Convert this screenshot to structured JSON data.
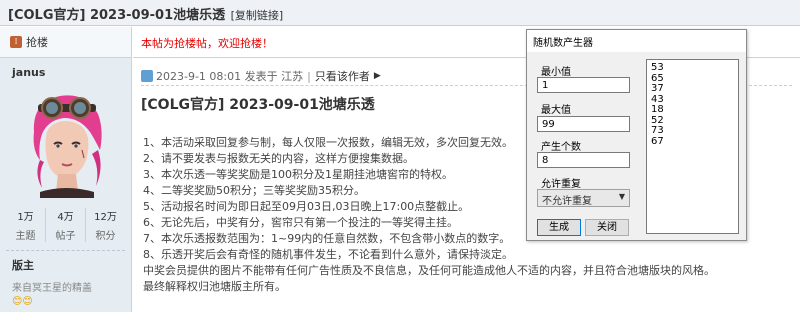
{
  "title_bar": {
    "title": "[COLG官方] 2023-09-01池塘乐透",
    "copy_link": "[复制链接]"
  },
  "sidebar": {
    "floor_label": "抢楼",
    "username": "janus",
    "stats": [
      {
        "value": "1万",
        "key": "主题"
      },
      {
        "value": "4万",
        "key": "帖子"
      },
      {
        "value": "12万",
        "key": "积分"
      }
    ],
    "group": "版主",
    "from": "来自冥王星的精盖",
    "emoji": "😊😊"
  },
  "post": {
    "notice": "本帖为抢楼帖，欢迎抢楼！",
    "meta_text": "2023-9-1 08:01 发表于 江苏",
    "separator": "|",
    "only_author": "只看该作者",
    "title": "[COLG官方] 2023-09-01池塘乐透",
    "lines": [
      "1、本活动采取回复参与制，每人仅限一次报数，编辑无效，多次回复无效。",
      "2、请不要发表与报数无关的内容，这样方便搜集数据。",
      "3、本次乐透一等奖奖励是100积分及1星期挂池塘窖帘的特权。",
      "4、二等奖奖励50积分；三等奖奖励35积分。",
      "5、活动报名时间为即日起至09月03日,03日晚上17:00点整截止。",
      "6、无论先后，中奖有分，窖帘只有第一个投注的一等奖得主挂。",
      "7、本次乐透报数范围为：1~99内的任意自然数，不包含带小数点的数字。",
      "8、乐透开奖后会有奇怪的随机事件发生，不论看到什么意外，请保持淡定。",
      "中奖会员提供的图片不能带有任何广告性质及不良信息，及任何可能造成他人不适的内容，并且符合池塘版块的风格。",
      "最终解释权归池塘版主所有。"
    ]
  },
  "dialog": {
    "title": "随机数产生器",
    "min_label": "最小值",
    "min_value": "1",
    "max_label": "最大值",
    "max_value": "99",
    "count_label": "产生个数",
    "count_value": "8",
    "repeat_label": "允许重复",
    "repeat_selected": "不允许重复",
    "generate_button": "生成",
    "close_button": "关闭",
    "results": [
      "53",
      "65",
      "37",
      "43",
      "18",
      "52",
      "73",
      "67"
    ]
  }
}
